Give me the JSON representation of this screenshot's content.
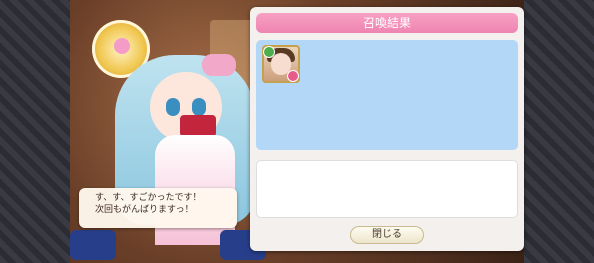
{
  "character": {
    "dialogue": "す、す、すごかったです！\n次回もがんばりますっ！"
  },
  "result_panel": {
    "title": "召喚結果",
    "cards": [
      {
        "icon": "character-card-icon",
        "attribute_icon": "green-attribute-icon",
        "rarity_icon": "pink-rarity-icon"
      }
    ],
    "close_label": "閉じる"
  },
  "colors": {
    "title_bar": "#ee84b0",
    "results_background": "#b3d7f7",
    "panel_background": "#f3f0ee"
  }
}
